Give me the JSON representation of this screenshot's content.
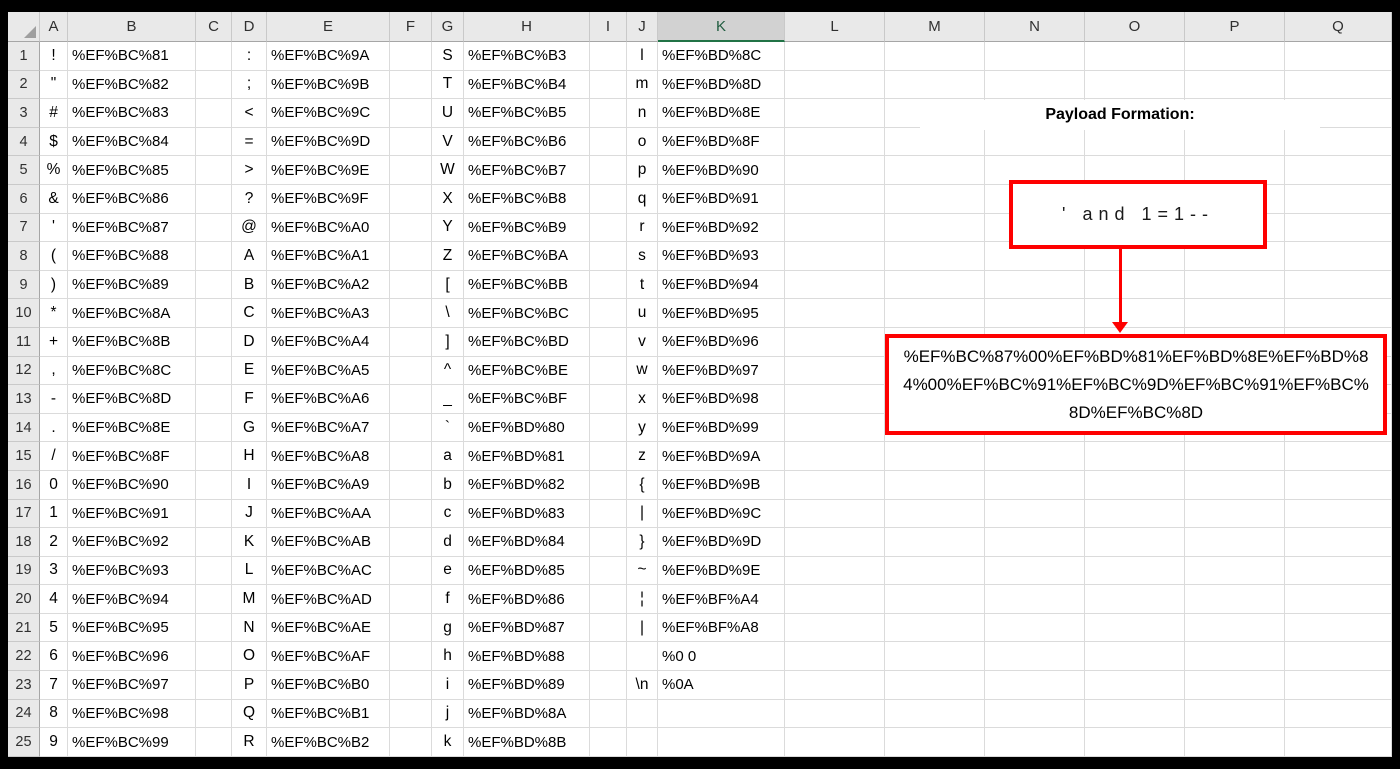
{
  "colors": {
    "shape_red": "#FE0000",
    "selection_green": "#217346",
    "header_bg": "#E9E9E9",
    "selected_header_bg": "#D2D2D2",
    "gridline": "#DBDBDB"
  },
  "sheet": {
    "selected_column": "K",
    "column_headers": [
      "A",
      "B",
      "C",
      "D",
      "E",
      "F",
      "G",
      "H",
      "I",
      "J",
      "K",
      "L",
      "M",
      "N",
      "O",
      "P",
      "Q"
    ],
    "row_headers": [
      "1",
      "2",
      "3",
      "4",
      "5",
      "6",
      "7",
      "8",
      "9",
      "10",
      "11",
      "12",
      "13",
      "14",
      "15",
      "16",
      "17",
      "18",
      "19",
      "20",
      "21",
      "22",
      "23",
      "24",
      "25"
    ],
    "rows": [
      [
        "!",
        "%EF%BC%81",
        ":",
        "%EF%BC%9A",
        "S",
        "%EF%BC%B3",
        "l",
        "%EF%BD%8C"
      ],
      [
        "\"",
        "%EF%BC%82",
        ";",
        "%EF%BC%9B",
        "T",
        "%EF%BC%B4",
        "m",
        "%EF%BD%8D"
      ],
      [
        "#",
        "%EF%BC%83",
        "<",
        "%EF%BC%9C",
        "U",
        "%EF%BC%B5",
        "n",
        "%EF%BD%8E"
      ],
      [
        "$",
        "%EF%BC%84",
        "=",
        "%EF%BC%9D",
        "V",
        "%EF%BC%B6",
        "o",
        "%EF%BD%8F"
      ],
      [
        "%",
        "%EF%BC%85",
        ">",
        "%EF%BC%9E",
        "W",
        "%EF%BC%B7",
        "p",
        "%EF%BD%90"
      ],
      [
        "&",
        "%EF%BC%86",
        "?",
        "%EF%BC%9F",
        "X",
        "%EF%BC%B8",
        "q",
        "%EF%BD%91"
      ],
      [
        "'",
        "%EF%BC%87",
        "@",
        "%EF%BC%A0",
        "Y",
        "%EF%BC%B9",
        "r",
        "%EF%BD%92"
      ],
      [
        "(",
        "%EF%BC%88",
        "A",
        "%EF%BC%A1",
        "Z",
        "%EF%BC%BA",
        "s",
        "%EF%BD%93"
      ],
      [
        ")",
        "%EF%BC%89",
        "B",
        "%EF%BC%A2",
        "[",
        "%EF%BC%BB",
        "t",
        "%EF%BD%94"
      ],
      [
        "*",
        "%EF%BC%8A",
        "C",
        "%EF%BC%A3",
        "\\",
        "%EF%BC%BC",
        "u",
        "%EF%BD%95"
      ],
      [
        "+",
        "%EF%BC%8B",
        "D",
        "%EF%BC%A4",
        "]",
        "%EF%BC%BD",
        "v",
        "%EF%BD%96"
      ],
      [
        ",",
        "%EF%BC%8C",
        "E",
        "%EF%BC%A5",
        "^",
        "%EF%BC%BE",
        "w",
        "%EF%BD%97"
      ],
      [
        "-",
        "%EF%BC%8D",
        "F",
        "%EF%BC%A6",
        "_",
        "%EF%BC%BF",
        "x",
        "%EF%BD%98"
      ],
      [
        ".",
        "%EF%BC%8E",
        "G",
        "%EF%BC%A7",
        "`",
        "%EF%BD%80",
        "y",
        "%EF%BD%99"
      ],
      [
        "/",
        "%EF%BC%8F",
        "H",
        "%EF%BC%A8",
        "a",
        "%EF%BD%81",
        "z",
        "%EF%BD%9A"
      ],
      [
        "0",
        "%EF%BC%90",
        "I",
        "%EF%BC%A9",
        "b",
        "%EF%BD%82",
        "{",
        "%EF%BD%9B"
      ],
      [
        "1",
        "%EF%BC%91",
        "J",
        "%EF%BC%AA",
        "c",
        "%EF%BD%83",
        "|",
        "%EF%BD%9C"
      ],
      [
        "2",
        "%EF%BC%92",
        "K",
        "%EF%BC%AB",
        "d",
        "%EF%BD%84",
        "}",
        "%EF%BD%9D"
      ],
      [
        "3",
        "%EF%BC%93",
        "L",
        "%EF%BC%AC",
        "e",
        "%EF%BD%85",
        "~",
        "%EF%BD%9E"
      ],
      [
        "4",
        "%EF%BC%94",
        "M",
        "%EF%BC%AD",
        "f",
        "%EF%BD%86",
        "¦",
        "%EF%BF%A4"
      ],
      [
        "5",
        "%EF%BC%95",
        "N",
        "%EF%BC%AE",
        "g",
        "%EF%BD%87",
        "|",
        "%EF%BF%A8"
      ],
      [
        "6",
        "%EF%BC%96",
        "O",
        "%EF%BC%AF",
        "h",
        "%EF%BD%88",
        "",
        "%0 0"
      ],
      [
        "7",
        "%EF%BC%97",
        "P",
        "%EF%BC%B0",
        "i",
        "%EF%BD%89",
        "\\n",
        "%0A"
      ],
      [
        "8",
        "%EF%BC%98",
        "Q",
        "%EF%BC%B1",
        "j",
        "%EF%BD%8A",
        "",
        ""
      ],
      [
        "9",
        "%EF%BC%99",
        "R",
        "%EF%BC%B2",
        "k",
        "%EF%BD%8B",
        "",
        ""
      ]
    ]
  },
  "annotation": {
    "title": "Payload Formation:",
    "source_text": "' and 1=1--",
    "payload": "%EF%BC%87%00%EF%BD%81%EF%BD%8E%EF%BD%84%00%EF%BC%91%EF%BC%9D%EF%BC%91%EF%BC%8D%EF%BC%8D"
  }
}
